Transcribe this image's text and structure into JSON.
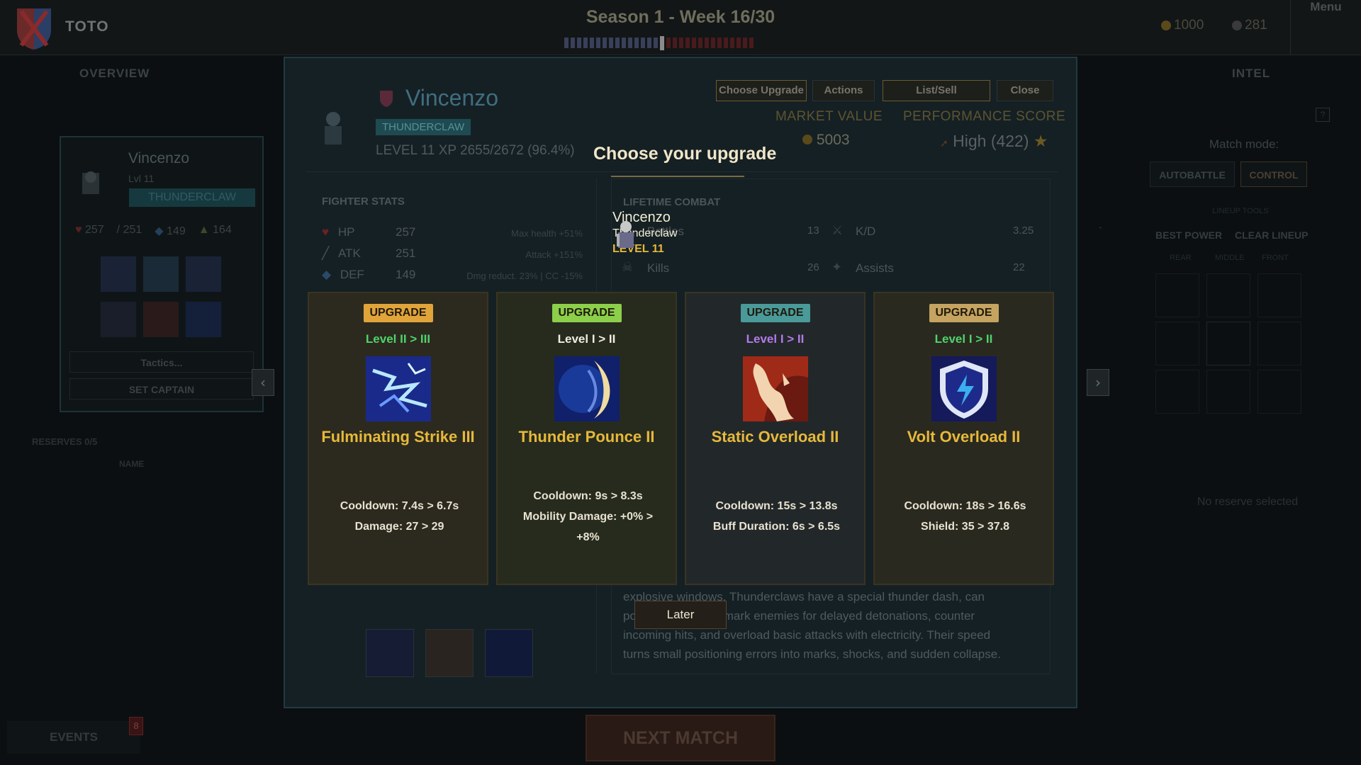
{
  "topbar": {
    "team_name": "TOTO",
    "season": "Season 1 - Week 16/30",
    "gold": "1000",
    "gems": "281",
    "menu": "Menu"
  },
  "background": {
    "overview": "OVERVIEW",
    "intel": "INTEL",
    "card_name": "Vincenzo",
    "card_level": "Lvl 11",
    "card_class": "THUNDERCLAW",
    "card_hp": "257",
    "card_atk": "251",
    "card_def": "149",
    "card_spd": "164",
    "tactics": "Tactics...",
    "set_captain": "SET CAPTAIN",
    "reserves": "RESERVES  0/5",
    "name_col": "NAME",
    "match_mode": "Match mode:",
    "autobattle": "AUTOBATTLE",
    "control": "CONTROL",
    "lineup_tools": "LINEUP TOOLS",
    "best_power": "BEST POWER",
    "clear_lineup": "CLEAR LINEUP",
    "rear": "REAR",
    "middle": "MIDDLE",
    "front": "FRONT",
    "no_reserve": "No reserve selected",
    "events": "EVENTS",
    "events_count": "8",
    "next_match": "NEXT MATCH",
    "help": "?",
    "dash": "-"
  },
  "modal": {
    "hero_name": "Vincenzo",
    "class_badge": "THUNDERCLAW",
    "level_line": "LEVEL 11   XP 2655/2672 (96.4%)",
    "btn_choose": "Choose Upgrade",
    "btn_actions": "Actions",
    "btn_list": "List/Sell",
    "btn_close": "Close",
    "market_value_label": "MARKET VALUE",
    "market_value": "5003",
    "perf_label": "PERFORMANCE SCORE",
    "perf_value": "High (422)",
    "fighter_stats": "FIGHTER STATS",
    "stats": [
      {
        "label": "HP",
        "value": "257",
        "note": "Max health +51%",
        "icon": "heart-icon"
      },
      {
        "label": "ATK",
        "value": "251",
        "note": "Attack +151%",
        "icon": "sword-icon"
      },
      {
        "label": "DEF",
        "value": "149",
        "note": "Dmg reduct. 23% | CC -15%",
        "icon": "shield-icon"
      }
    ],
    "lifetime_combat": "LIFETIME COMBAT",
    "combat": [
      {
        "label": "Battles",
        "value": "13"
      },
      {
        "label": "K/D",
        "value": "3.25"
      },
      {
        "label": "Kills",
        "value": "26"
      },
      {
        "label": "Assists",
        "value": "22"
      }
    ],
    "lore_lines": [
      "explosive windows. Thunderclaws have a special thunder dash, can",
      "po                          mark enemies for delayed detonations, counter",
      "incoming hits, and overload basic attacks with electricity. Their speed",
      "turns small positioning errors into marks, shocks, and sudden collapse."
    ]
  },
  "upgrade": {
    "title": "Choose your upgrade",
    "tooltip": {
      "name": "Vincenzo",
      "class": "Thunderclaw",
      "level": "LEVEL 11"
    },
    "cards": [
      {
        "badge": "UPGRADE",
        "level": "Level II > III",
        "name": "Fulminating Strike III",
        "desc": [
          "Cooldown: 7.4s > 6.7s",
          "Damage: 27 > 29"
        ],
        "badge_color": "#e0a43a",
        "level_color": "#4ed36a",
        "bg_color": "#2c2a1f",
        "icon": "lightning-strike-icon"
      },
      {
        "badge": "UPGRADE",
        "level": "Level I > II",
        "name": "Thunder Pounce II",
        "desc": [
          "Cooldown: 9s > 8.3s",
          "Mobility Damage: +0% >",
          "+8%"
        ],
        "badge_color": "#8ccf4a",
        "level_color": "#f0ece0",
        "bg_color": "#272b1e",
        "icon": "crescent-pounce-icon"
      },
      {
        "badge": "UPGRADE",
        "level": "Level I > II",
        "name": "Static Overload II",
        "desc": [
          "Cooldown: 15s > 13.8s",
          "Buff Duration: 6s > 6.5s"
        ],
        "badge_color": "#4a9a9a",
        "level_color": "#b47ae8",
        "bg_color": "#22282a",
        "icon": "beast-claw-icon"
      },
      {
        "badge": "UPGRADE",
        "level": "Level I > II",
        "name": "Volt Overload II",
        "desc": [
          "Cooldown: 18s > 16.6s",
          "Shield: 35 > 37.8"
        ],
        "badge_color": "#c4a460",
        "level_color": "#4ed36a",
        "bg_color": "#2a2920",
        "icon": "lightning-shield-icon"
      }
    ],
    "later": "Later"
  }
}
